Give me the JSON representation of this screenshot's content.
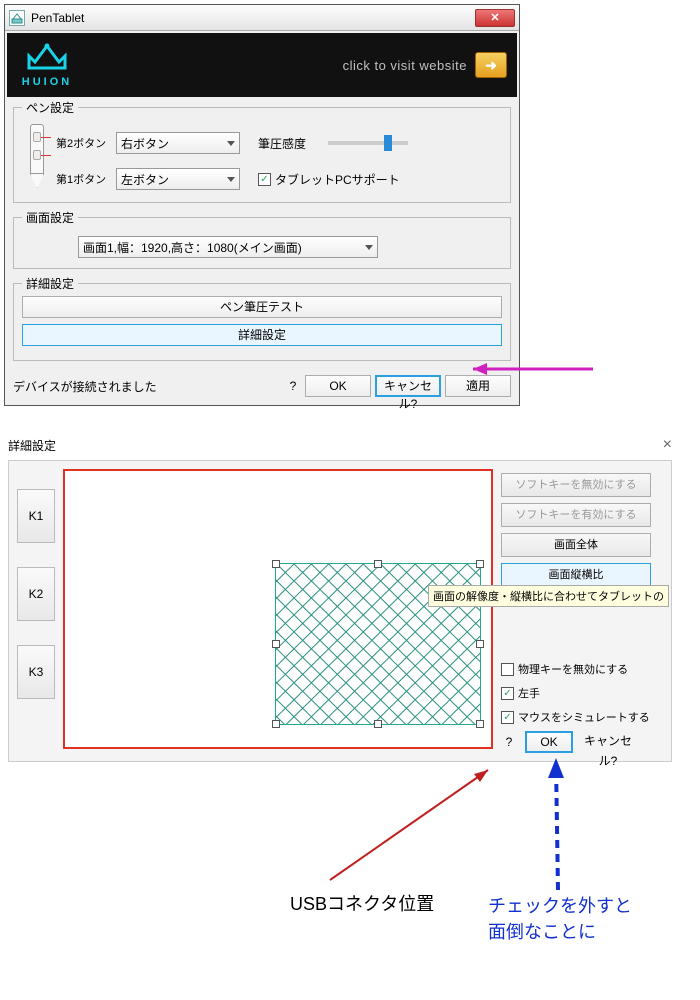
{
  "window1": {
    "title": "PenTablet",
    "banner": {
      "logo_text": "HUION",
      "visit_text": "click to visit website",
      "arrow": "➜"
    },
    "pen_settings": {
      "legend": "ペン設定",
      "button2_label": "第2ボタン",
      "button2_value": "右ボタン",
      "button1_label": "第1ボタン",
      "button1_value": "左ボタン",
      "pressure_label": "筆圧感度",
      "tablet_pc_label": "タブレットPCサポート"
    },
    "screen_settings": {
      "legend": "画面設定",
      "value": "画面1,幅：1920,高さ：1080(メイン画面)"
    },
    "advanced": {
      "legend": "詳細設定",
      "test_btn": "ペン筆圧テスト",
      "advanced_btn": "詳細設定"
    },
    "status": "デバイスが接続されました",
    "help": "?",
    "ok": "OK",
    "cancel": "キャンセル?",
    "apply": "適用"
  },
  "window2": {
    "title": "詳細設定",
    "close": "×",
    "keys": [
      "K1",
      "K2",
      "K3"
    ],
    "right": {
      "softkey_disable": "ソフトキーを無効にする",
      "softkey_enable": "ソフトキーを有効にする",
      "full_screen": "画面全体",
      "aspect_ratio": "画面縦横比",
      "tooltip": "画面の解像度・縦横比に合わせてタブレットの",
      "physkey_disable": "物理キーを無効にする",
      "left_hand": "左手",
      "simulate_mouse": "マウスをシミュレートする"
    },
    "help": "?",
    "ok": "OK",
    "cancel": "キャンセル?"
  },
  "annotations": {
    "usb": "USBコネクタ位置",
    "check_warn1": "チェックを外すと",
    "check_warn2": "面倒なことに"
  }
}
